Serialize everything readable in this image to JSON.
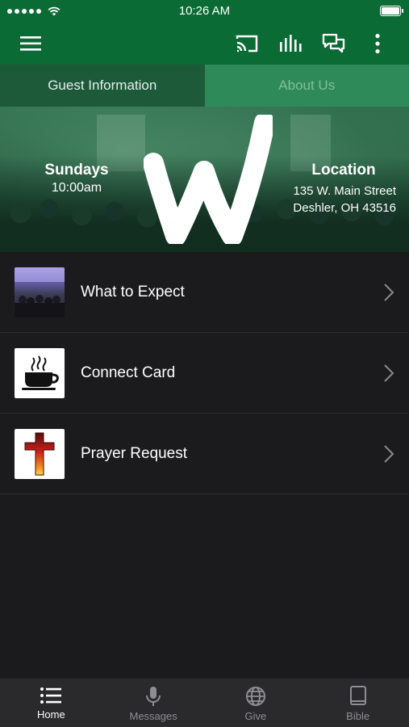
{
  "status_bar": {
    "time": "10:26 AM"
  },
  "app_bar": {
    "icons": [
      "hamburger-menu-icon",
      "cast-icon",
      "equalizer-icon",
      "chat-icon",
      "more-vertical-icon"
    ],
    "accent": "#0b6b35"
  },
  "tabs": [
    {
      "label": "Guest Information",
      "active": true
    },
    {
      "label": "About Us",
      "active": false
    }
  ],
  "hero": {
    "service_day": "Sundays",
    "service_time": "10:00am",
    "location_title": "Location",
    "address_line1": "135 W. Main Street",
    "address_line2": "Deshler, OH 43516"
  },
  "list": [
    {
      "label": "What to Expect",
      "thumbnail": "church-photo"
    },
    {
      "label": "Connect Card",
      "thumbnail": "coffee-cup-icon"
    },
    {
      "label": "Prayer Request",
      "thumbnail": "cross-icon"
    }
  ],
  "bottom_nav": [
    {
      "label": "Home",
      "icon": "list-icon",
      "active": true
    },
    {
      "label": "Messages",
      "icon": "microphone-icon",
      "active": false
    },
    {
      "label": "Give",
      "icon": "globe-icon",
      "active": false
    },
    {
      "label": "Bible",
      "icon": "book-icon",
      "active": false
    }
  ]
}
